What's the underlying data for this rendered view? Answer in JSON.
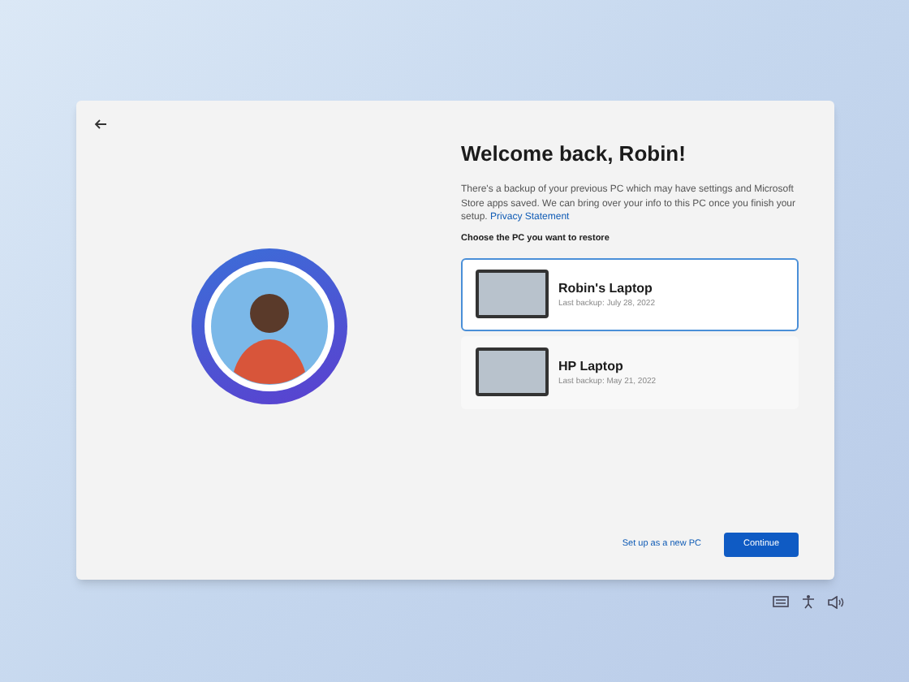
{
  "title": "Welcome back, Robin!",
  "description": "There's a backup of your previous PC which may have settings and Microsoft Store apps saved. We can bring over your info to this PC once you finish your setup.",
  "privacy_link": "Privacy Statement",
  "prompt": "Choose the PC you want to restore",
  "pcs": [
    {
      "name": "Robin's Laptop",
      "last_backup": "Last backup: July 28, 2022",
      "selected": true
    },
    {
      "name": "HP Laptop",
      "last_backup": "Last backup: May 21, 2022",
      "selected": false
    }
  ],
  "secondary_action": "Set up as a new PC",
  "primary_action": "Continue"
}
